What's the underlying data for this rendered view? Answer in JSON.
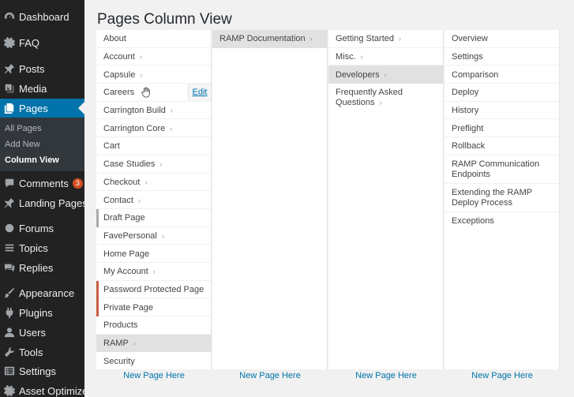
{
  "sidebar": {
    "items": [
      {
        "label": "Dashboard",
        "icon": "dashboard-icon"
      },
      {
        "label": "FAQ",
        "icon": "gear-icon"
      },
      {
        "label": "Posts",
        "icon": "pin-icon"
      },
      {
        "label": "Media",
        "icon": "media-icon"
      },
      {
        "label": "Pages",
        "icon": "pages-icon"
      },
      {
        "label": "Comments",
        "icon": "comment-icon",
        "badge": "3"
      },
      {
        "label": "Landing Pages",
        "icon": "pin-icon"
      },
      {
        "label": "Forums",
        "icon": "forums-icon"
      },
      {
        "label": "Topics",
        "icon": "topics-icon"
      },
      {
        "label": "Replies",
        "icon": "replies-icon"
      },
      {
        "label": "Appearance",
        "icon": "brush-icon"
      },
      {
        "label": "Plugins",
        "icon": "plug-icon"
      },
      {
        "label": "Users",
        "icon": "user-icon"
      },
      {
        "label": "Tools",
        "icon": "wrench-icon"
      },
      {
        "label": "Settings",
        "icon": "settings-icon"
      },
      {
        "label": "Asset Optimizer",
        "icon": "gear-icon"
      }
    ],
    "submenu": [
      "All Pages",
      "Add New",
      "Column View"
    ]
  },
  "page_title": "Pages Column View",
  "columns": [
    {
      "items": [
        {
          "label": "About",
          "children": false
        },
        {
          "label": "Account",
          "children": true
        },
        {
          "label": "Capsule",
          "children": true
        },
        {
          "label": "Careers",
          "children": false,
          "edit": "Edit"
        },
        {
          "label": "Carrington Build",
          "children": true
        },
        {
          "label": "Carrington Core",
          "children": true
        },
        {
          "label": "Cart",
          "children": false
        },
        {
          "label": "Case Studies",
          "children": true
        },
        {
          "label": "Checkout",
          "children": true
        },
        {
          "label": "Contact",
          "children": true
        },
        {
          "label": "Draft Page",
          "children": false,
          "status": "draft"
        },
        {
          "label": "FavePersonal",
          "children": true
        },
        {
          "label": "Home Page",
          "children": false
        },
        {
          "label": "My Account",
          "children": true
        },
        {
          "label": "Password Protected Page",
          "children": false,
          "status": "protected"
        },
        {
          "label": "Private Page",
          "children": false,
          "status": "private"
        },
        {
          "label": "Products",
          "children": false
        },
        {
          "label": "RAMP",
          "children": true,
          "selected": true
        },
        {
          "label": "Security",
          "children": false
        }
      ],
      "new_page": "New Page Here"
    },
    {
      "items": [
        {
          "label": "RAMP Documentation",
          "children": true,
          "selected": true
        }
      ],
      "new_page": "New Page Here"
    },
    {
      "items": [
        {
          "label": "Getting Started",
          "children": true
        },
        {
          "label": "Misc.",
          "children": true
        },
        {
          "label": "Developers",
          "children": true,
          "selected": true
        },
        {
          "label": "Frequently Asked Questions",
          "children": true,
          "tall": true
        }
      ],
      "new_page": "New Page Here"
    },
    {
      "items": [
        {
          "label": "Overview",
          "children": false
        },
        {
          "label": "Settings",
          "children": false
        },
        {
          "label": "Comparison",
          "children": false
        },
        {
          "label": "Deploy",
          "children": false
        },
        {
          "label": "History",
          "children": false
        },
        {
          "label": "Preflight",
          "children": false
        },
        {
          "label": "Rollback",
          "children": false
        },
        {
          "label": "RAMP Communication Endpoints",
          "children": false,
          "tall": true
        },
        {
          "label": "Extending the RAMP Deploy Process",
          "children": false,
          "tall": true
        },
        {
          "label": "Exceptions",
          "children": false
        }
      ],
      "new_page": "New Page Here"
    }
  ],
  "colors": {
    "accent": "#0073aa",
    "sidebar_bg": "#222222",
    "selected_row": "#e1e1e1",
    "status_mark": "#c85f43"
  }
}
